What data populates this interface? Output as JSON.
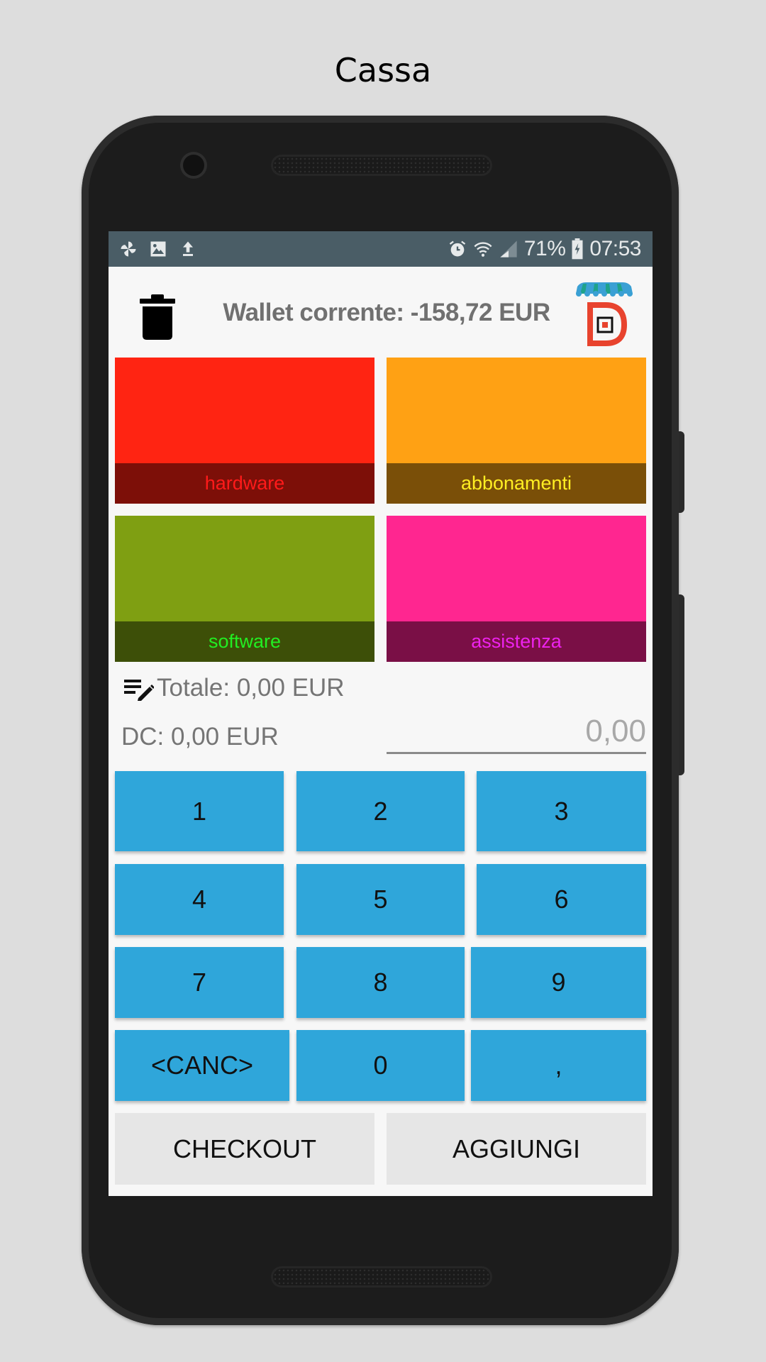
{
  "page_title": "Cassa",
  "status_bar": {
    "left_icons": [
      "pinwheel-icon",
      "image-icon",
      "upload-icon"
    ],
    "right_icons": [
      "alarm-icon",
      "wifi-icon",
      "signal-icon"
    ],
    "battery_percent": "71%",
    "battery_icon": "battery-charging-icon",
    "time": "07:53"
  },
  "header": {
    "delete_icon": "trash-icon",
    "wallet_label": "Wallet corrente: -158,72 EUR",
    "logo_icon": "store-logo-icon"
  },
  "categories": [
    {
      "label": "hardware",
      "color": "#ff2412",
      "band_color": "#7d0f08",
      "text_color": "#ff1a1a"
    },
    {
      "label": "abbonamenti",
      "color": "#ffa114",
      "band_color": "#7a4f08",
      "text_color": "#ffee22"
    },
    {
      "label": "software",
      "color": "#7f9f12",
      "band_color": "#3d4f08",
      "text_color": "#22ee22"
    },
    {
      "label": "assistenza",
      "color": "#ff2690",
      "band_color": "#7a0f46",
      "text_color": "#ee22ee"
    }
  ],
  "totals": {
    "list_edit_icon": "list-edit-icon",
    "totale": "Totale: 0,00 EUR",
    "dc": "DC: 0,00 EUR",
    "amount_placeholder": "0,00"
  },
  "keypad": {
    "keys": [
      "1",
      "2",
      "3",
      "4",
      "5",
      "6",
      "7",
      "8",
      "9",
      "<CANC>",
      "0",
      ","
    ],
    "color": "#2fa6da"
  },
  "actions": {
    "checkout": "CHECKOUT",
    "aggiungi": "AGGIUNGI"
  }
}
